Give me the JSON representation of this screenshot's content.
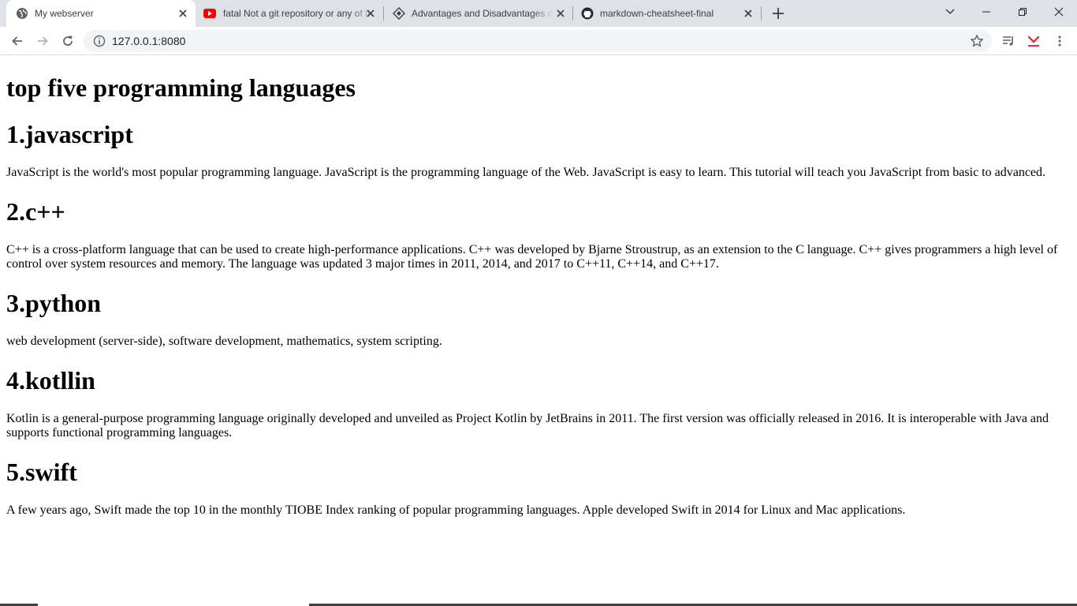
{
  "browser": {
    "tabs": [
      {
        "title": "My webserver",
        "icon": "globe-icon",
        "active": true
      },
      {
        "title": "fatal Not a git repository or any of the parent directories",
        "icon": "youtube-icon",
        "active": false
      },
      {
        "title": "Advantages and Disadvantages of Programming Languages",
        "icon": "diamond-icon",
        "active": false
      },
      {
        "title": "markdown-cheatsheet-final",
        "icon": "github-icon",
        "active": false
      }
    ],
    "url": "127.0.0.1:8080",
    "accent_colors": {
      "tabstrip": "#dee1e6",
      "youtube_red": "#ff0000",
      "pocket_red": "#e0303e"
    }
  },
  "page": {
    "title": "top five programming languages",
    "sections": [
      {
        "heading": "1.javascript",
        "text": "JavaScript is the world's most popular programming language. JavaScript is the programming language of the Web. JavaScript is easy to learn. This tutorial will teach you JavaScript from basic to advanced."
      },
      {
        "heading": "2.c++",
        "text": "C++ is a cross-platform language that can be used to create high-performance applications. C++ was developed by Bjarne Stroustrup, as an extension to the C language. C++ gives programmers a high level of control over system resources and memory. The language was updated 3 major times in 2011, 2014, and 2017 to C++11, C++14, and C++17."
      },
      {
        "heading": "3.python",
        "text": "web development (server-side), software development, mathematics, system scripting."
      },
      {
        "heading": "4.kotllin",
        "text": "Kotlin is a general-purpose programming language originally developed and unveiled as Project Kotlin by JetBrains in 2011. The first version was officially released in 2016. It is interoperable with Java and supports functional programming languages."
      },
      {
        "heading": "5.swift",
        "text": "A few years ago, Swift made the top 10 in the monthly TIOBE Index ranking of popular programming languages. Apple developed Swift in 2014 for Linux and Mac applications."
      }
    ]
  }
}
